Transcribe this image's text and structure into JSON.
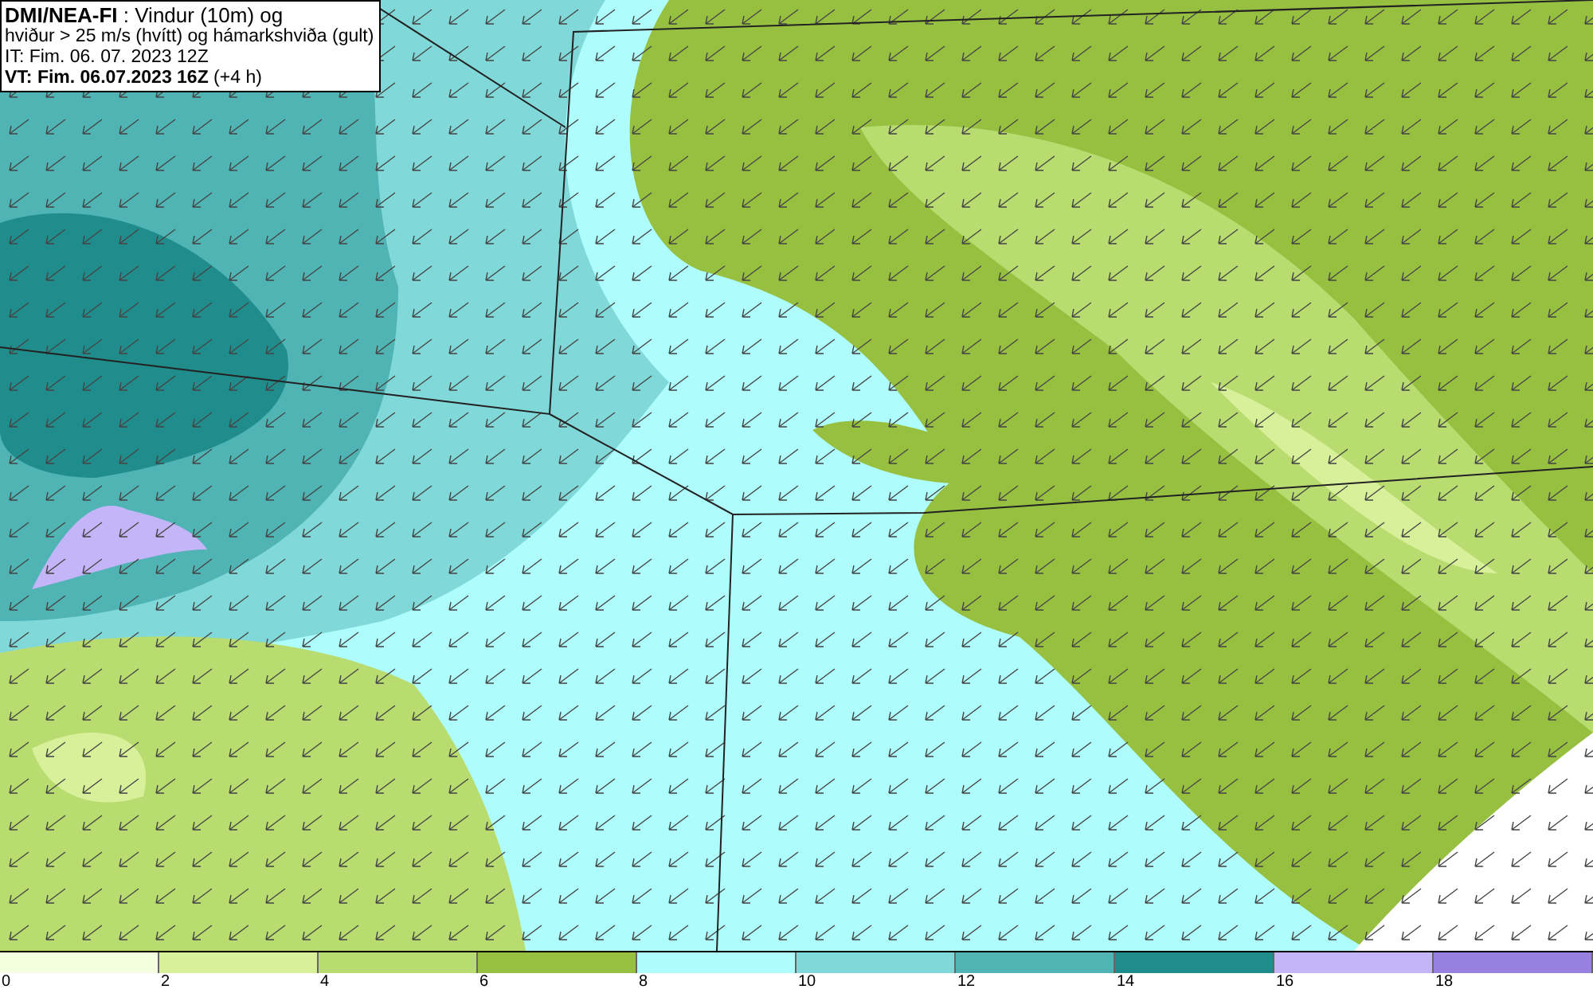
{
  "header": {
    "lines": [
      "**DMI/NEA-FI** : Vindur (10m) og",
      "hviður > 25 m/s (hvítt) og hámarkshviða (gult)",
      "IT: Fim. 06. 07. 2023 12Z",
      "**VT: Fim. 06.07.2023 16Z** (+4 h)"
    ]
  },
  "legend": [
    {
      "label": "0",
      "color": "#f4ffe0"
    },
    {
      "label": "2",
      "color": "#d8f09a"
    },
    {
      "label": "4",
      "color": "#b8dc70"
    },
    {
      "label": "6",
      "color": "#98c040"
    },
    {
      "label": "8",
      "color": "#aefcfc"
    },
    {
      "label": "10",
      "color": "#80d8d8"
    },
    {
      "label": "12",
      "color": "#50b4b4"
    },
    {
      "label": "14",
      "color": "#208c8c"
    },
    {
      "label": "16",
      "color": "#c4b4f8"
    },
    {
      "label": "18",
      "color": "#9880e0"
    }
  ]
}
